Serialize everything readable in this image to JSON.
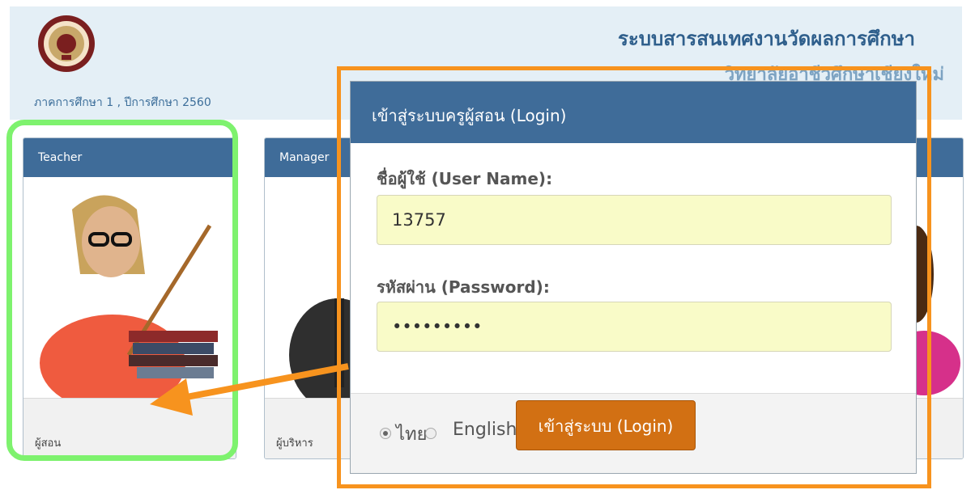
{
  "header": {
    "system_title": "ระบบสารสนเทศงานวัดผลการศึกษา",
    "sub_title": "วิทยาลัยอาชีวศึกษาเชียงใหม่",
    "term_text": "ภาคการศึกษา 1 , ปีการศึกษา 2560"
  },
  "cards": [
    {
      "title": "Teacher",
      "footer": "ผู้สอน"
    },
    {
      "title": "Manager",
      "footer": "ผู้บริหาร"
    }
  ],
  "login_modal": {
    "title": "เข้าสู่ระบบครูผู้สอน (Login)",
    "username_label": "ชื่อผู้ใช้ (User Name):",
    "username_value": "13757",
    "password_label": "รหัสผ่าน (Password):",
    "password_value": "•••••••••",
    "lang_thai": "ไทย",
    "lang_english": "English",
    "login_button": "เข้าสู่ระบบ (Login)"
  },
  "colors": {
    "header_bg": "#e4eff6",
    "panel_blue": "#3f6c99",
    "input_bg": "#f9fbc8",
    "login_orange": "#d27013",
    "highlight_green": "#7ef26e",
    "highlight_orange": "#f7931e"
  },
  "icons": {
    "logo": "vocational-seal-icon",
    "teacher": "teacher-icon",
    "manager": "manager-icon"
  }
}
